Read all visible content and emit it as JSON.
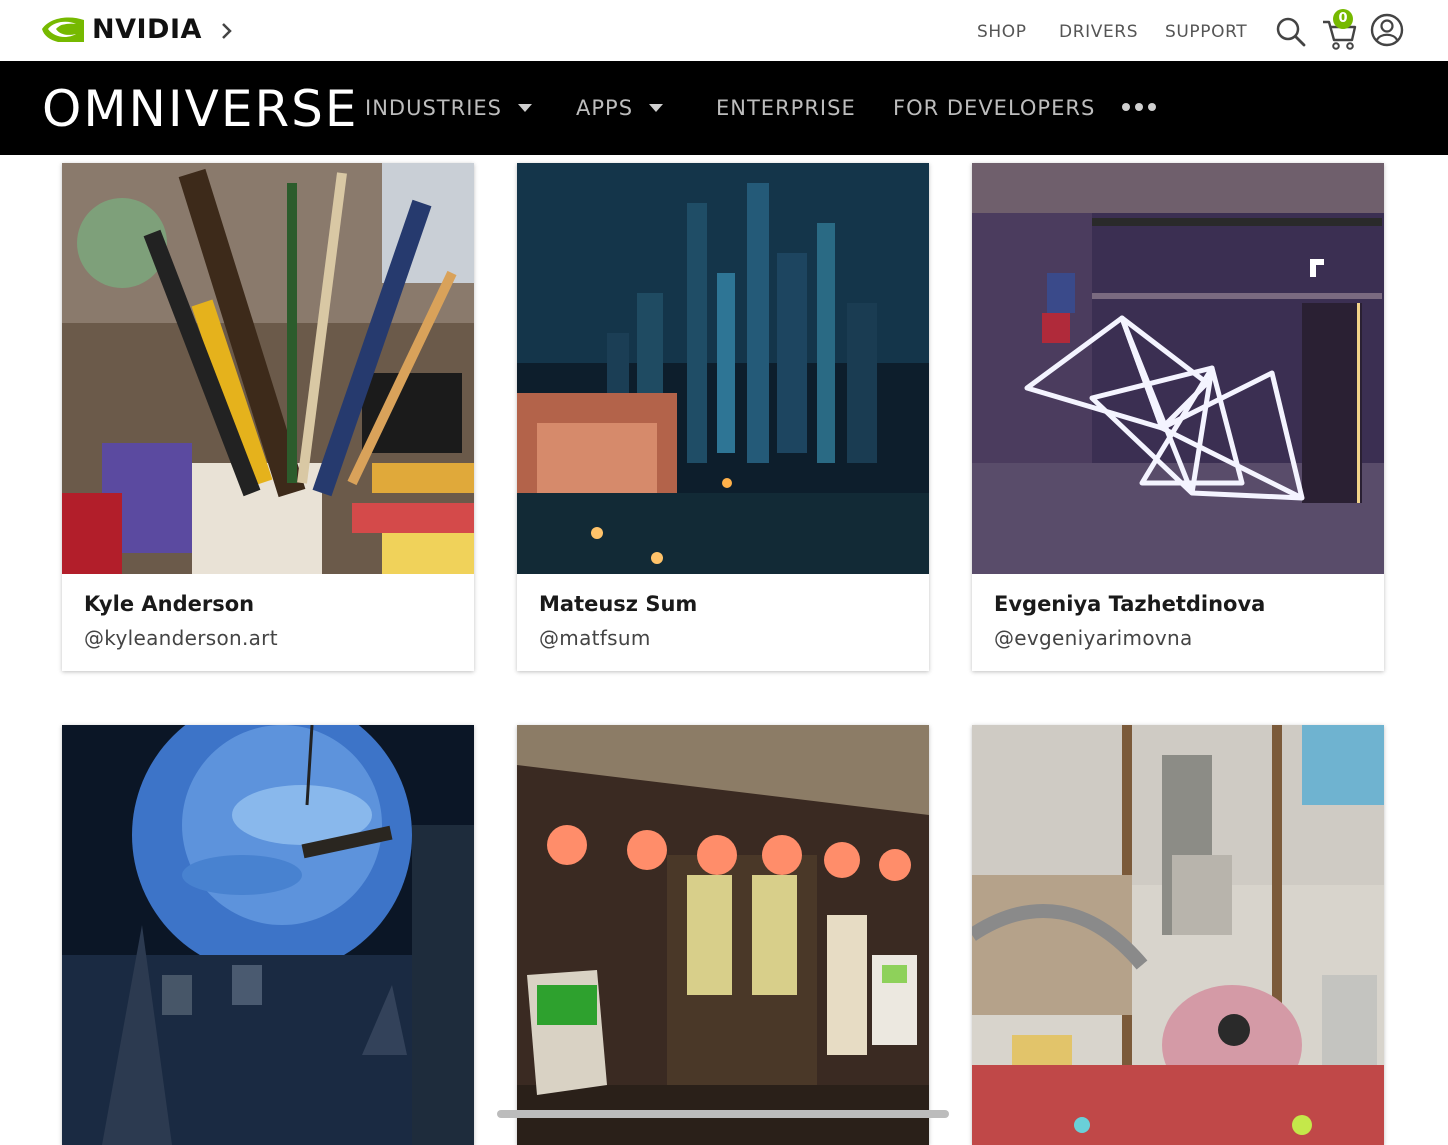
{
  "header": {
    "brand": "NVIDIA",
    "nav": {
      "shop": "SHOP",
      "drivers": "DRIVERS",
      "support": "SUPPORT"
    },
    "cart_count": "0",
    "icons": [
      "nvidia-logo-icon",
      "chevron-right-icon",
      "search-icon",
      "cart-icon",
      "account-icon"
    ],
    "accent_color": "#76b900"
  },
  "omniverse_bar": {
    "title": "OMNIVERSE",
    "items": [
      {
        "label": "INDUSTRIES",
        "has_dropdown": true
      },
      {
        "label": "APPS",
        "has_dropdown": true
      },
      {
        "label": "ENTERPRISE",
        "has_dropdown": false
      },
      {
        "label": "FOR DEVELOPERS",
        "has_dropdown": false
      }
    ],
    "more_icon": "more-dots-icon"
  },
  "gallery": {
    "cards": [
      {
        "name": "Kyle Anderson",
        "handle": "@kyleanderson.art",
        "image": "art-supplies-brushes"
      },
      {
        "name": "Mateusz Sum",
        "handle": "@matfsum",
        "image": "toy-castle-night"
      },
      {
        "name": "Evgeniya Tazhetdinova",
        "handle": "@evgeniyarimovna",
        "image": "neon-geometric-sculpture"
      },
      {
        "name": "",
        "handle": "",
        "image": "blue-moon-scene"
      },
      {
        "name": "",
        "handle": "",
        "image": "storefront-lamps"
      },
      {
        "name": "",
        "handle": "",
        "image": "robot-workshop"
      }
    ]
  }
}
